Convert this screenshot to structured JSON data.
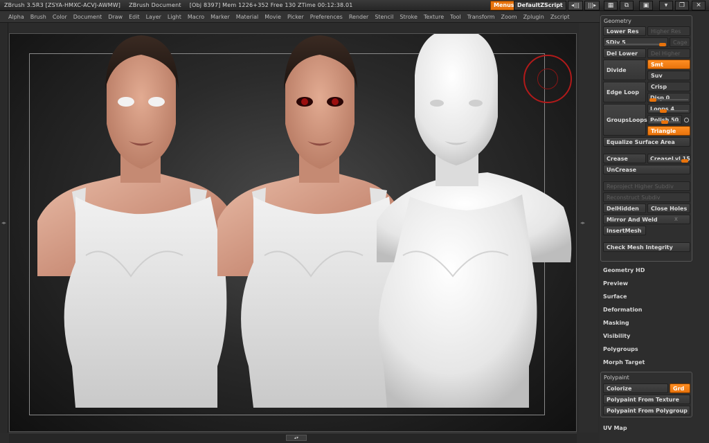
{
  "titlebar": {
    "app_title": "ZBrush 3.5R3 [ZSYA-HMXC-ACVJ-AWMW]",
    "doc_title": "ZBrush Document",
    "stats": "[Obj 8397] Mem 1226+352 Free 130 ZTime 00:12:38.01",
    "menus_button": "Menus",
    "zscript_button": "DefaultZScript",
    "arrows_left": "◂|||",
    "arrows_right": "|||▸"
  },
  "menubar": {
    "items": [
      "Alpha",
      "Brush",
      "Color",
      "Document",
      "Draw",
      "Edit",
      "Layer",
      "Light",
      "Macro",
      "Marker",
      "Material",
      "Movie",
      "Picker",
      "Preferences",
      "Render",
      "Stencil",
      "Stroke",
      "Texture",
      "Tool",
      "Transform",
      "Zoom",
      "Zplugin",
      "Zscript"
    ]
  },
  "geometry": {
    "title": "Geometry",
    "lower_res": "Lower Res",
    "higher_res": "Higher Res",
    "sdiv_label": "SDiv 5",
    "sdiv_value": 5,
    "cage": "Cage",
    "del_lower": "Del Lower",
    "del_higher": "Del Higher",
    "divide": "Divide",
    "smt": "Smt",
    "suv": "Suv",
    "edge_loop": "Edge Loop",
    "crisp": "Crisp",
    "disp_label": "Disp 0",
    "disp_value": 0,
    "groups_loops": "GroupsLoops",
    "loops_label": "Loops 4",
    "loops_value": 4,
    "polish_label": "Polish 50",
    "polish_value": 50,
    "triangle": "Triangle",
    "equalize": "Equalize Surface Area",
    "crease": "Crease",
    "creaselvl_label": "CreaseLvl 15",
    "creaselvl_value": 15,
    "uncrease": "UnCrease",
    "reproject": "Reproject Higher Subdiv",
    "reconstruct": "Reconstruct Subdiv",
    "delhidden": "DelHidden",
    "close_holes": "Close Holes",
    "mirror_weld": "Mirror And Weld",
    "mirror_x": "X",
    "insert_mesh": "InsertMesh",
    "check_mesh": "Check Mesh Integrity"
  },
  "subpalettes": [
    "Geometry HD",
    "Preview",
    "Surface",
    "Deformation",
    "Masking",
    "Visibility",
    "Polygroups",
    "Morph Target"
  ],
  "polypaint": {
    "title": "Polypaint",
    "colorize": "Colorize",
    "grd": "Grd",
    "from_texture": "Polypaint From Texture",
    "from_polygroup": "Polypaint From Polygroup"
  },
  "uv_map": "UV Map",
  "colors": {
    "accent_orange": "#e8730c",
    "skin": "#d9a48e",
    "shirt": "#e6e6e6",
    "clay": "#e9e9e9",
    "eye_red": "#9b0f0f"
  }
}
